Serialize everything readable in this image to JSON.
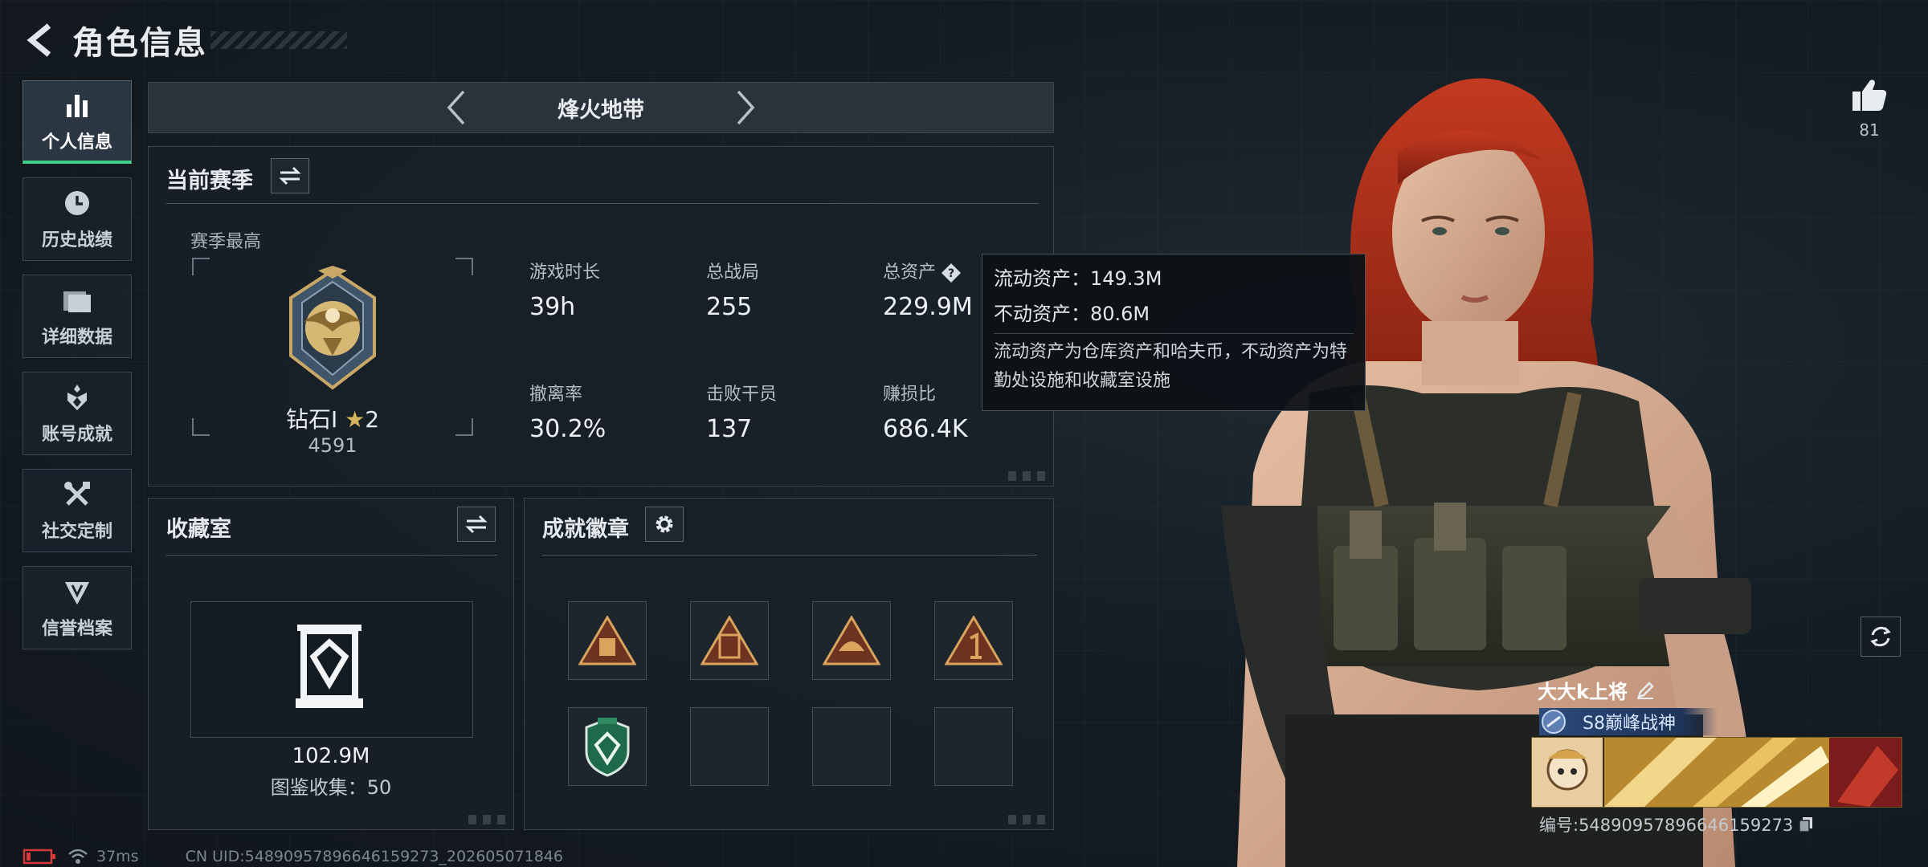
{
  "header": {
    "title": "角色信息"
  },
  "side_nav": {
    "items": [
      {
        "label": "个人信息",
        "icon": "bar-chart-icon",
        "active": true
      },
      {
        "label": "历史战绩",
        "icon": "clock-icon"
      },
      {
        "label": "详细数据",
        "icon": "folder-icon"
      },
      {
        "label": "账号成就",
        "icon": "achievement-icon"
      },
      {
        "label": "社交定制",
        "icon": "tools-icon"
      },
      {
        "label": "信誉档案",
        "icon": "emblem-icon"
      }
    ]
  },
  "mode": {
    "name": "烽火地带"
  },
  "season": {
    "title": "当前赛季",
    "best_label": "赛季最高",
    "rank_name": "钻石Ⅰ",
    "rank_stars": "2",
    "rank_score": "4591",
    "stats": [
      {
        "label": "游戏时长",
        "value": "39h"
      },
      {
        "label": "总战局",
        "value": "255"
      },
      {
        "label": "总资产",
        "value": "229.9M"
      },
      {
        "label": "撤离率",
        "value": "30.2%"
      },
      {
        "label": "击败干员",
        "value": "137"
      },
      {
        "label": "赚损比",
        "value": "686.4K"
      }
    ]
  },
  "tooltip": {
    "liquid": "流动资产：149.3M",
    "fixed": "不动资产：80.6M",
    "desc": "流动资产为仓库资产和哈夫币，不动资产为特勤处设施和收藏室设施"
  },
  "collection": {
    "title": "收藏室",
    "value": "102.9M",
    "count": "图鉴收集：50"
  },
  "badges": {
    "title": "成就徽章"
  },
  "profile": {
    "likes": "81",
    "name": "大大k上将",
    "title": "S8巅峰战神",
    "id": "编号:548909578966461592​73"
  },
  "footer": {
    "ping": "37ms",
    "uid": "CN UID:548909578966461592​73_202605071846"
  },
  "colors": {
    "accent": "#3fd08a",
    "panel": "#182028",
    "border": "#3a4550"
  }
}
